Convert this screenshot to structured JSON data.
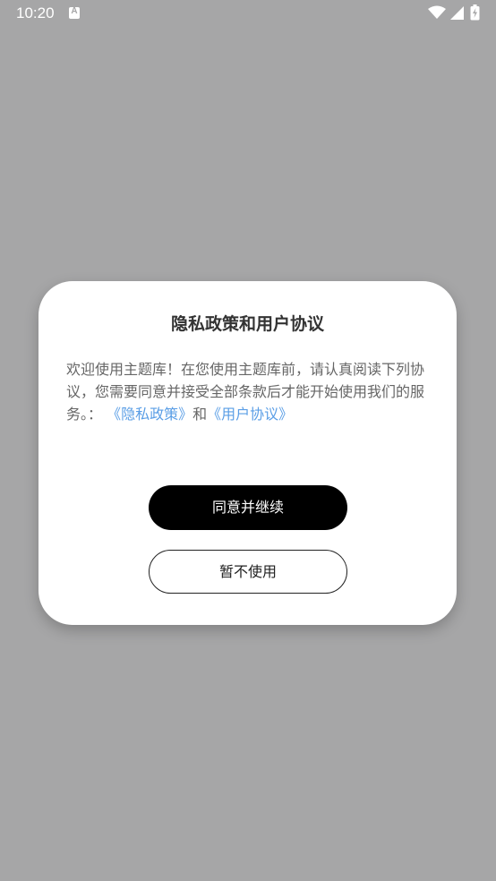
{
  "status_bar": {
    "time": "10:20",
    "notification_icon": "A"
  },
  "dialog": {
    "title": "隐私政策和用户协议",
    "body_text": "欢迎使用主题库！在您使用主题库前，请认真阅读下列协议，您需要同意并接受全部条款后才能开始使用我们的服务。：",
    "privacy_link": "《隐私政策》",
    "connector": "和",
    "agreement_link": "《用户协议》",
    "agree_label": "同意并继续",
    "decline_label": "暂不使用"
  },
  "colors": {
    "overlay": "#a6a6a7",
    "link": "#5a9ee6",
    "primary_button": "#000000"
  }
}
